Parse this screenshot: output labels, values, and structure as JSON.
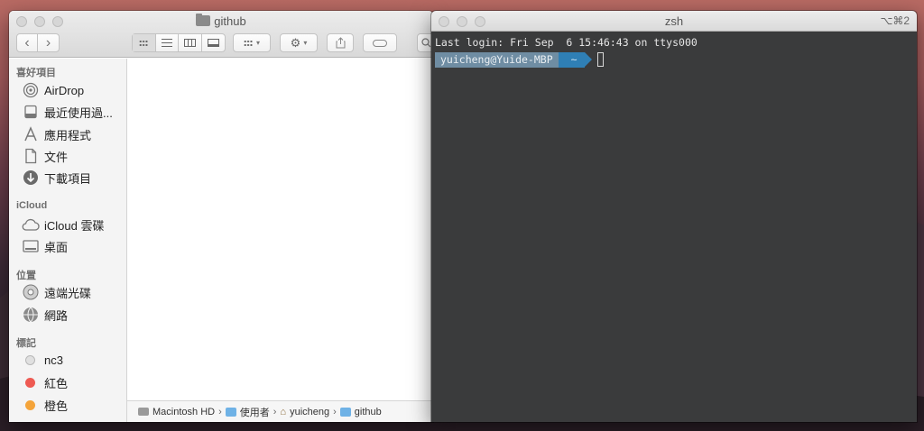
{
  "finder": {
    "title": "github",
    "toolbar": {
      "back": "‹",
      "forward": "›"
    },
    "sidebar": {
      "sections": [
        {
          "heading": "喜好項目",
          "items": [
            {
              "label": "AirDrop",
              "icon": "airdrop-icon"
            },
            {
              "label": "最近使用過...",
              "icon": "recents-icon"
            },
            {
              "label": "應用程式",
              "icon": "applications-icon"
            },
            {
              "label": "文件",
              "icon": "documents-icon"
            },
            {
              "label": "下載項目",
              "icon": "downloads-icon"
            }
          ]
        },
        {
          "heading": "iCloud",
          "items": [
            {
              "label": "iCloud 雲碟",
              "icon": "icloud-icon"
            },
            {
              "label": "桌面",
              "icon": "desktop-icon"
            }
          ]
        },
        {
          "heading": "位置",
          "items": [
            {
              "label": "遠端光碟",
              "icon": "disc-icon"
            },
            {
              "label": "網路",
              "icon": "network-icon"
            }
          ]
        },
        {
          "heading": "標記",
          "items": [
            {
              "label": "nc3",
              "color": "#d9d9d9"
            },
            {
              "label": "紅色",
              "color": "#ee5a52"
            },
            {
              "label": "橙色",
              "color": "#f4a43a"
            }
          ]
        }
      ]
    },
    "pathbar": {
      "segments": [
        "Macintosh HD",
        "使用者",
        "yuicheng",
        "github"
      ],
      "separator": "›"
    }
  },
  "terminal": {
    "title": "zsh",
    "shortcut": "⌥⌘2",
    "last_login": "Last login: Fri Sep  6 15:46:43 on ttys000",
    "prompt_user": "yuicheng@Yuide-MBP",
    "prompt_dir": "~"
  }
}
